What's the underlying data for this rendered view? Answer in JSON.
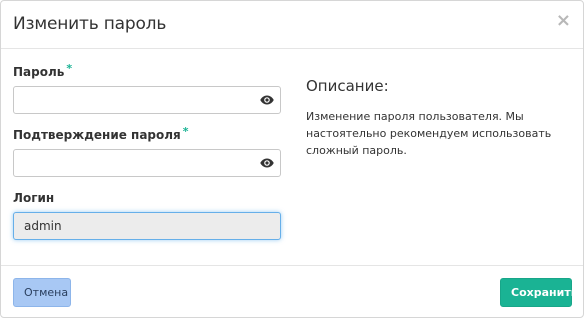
{
  "dialog": {
    "title": "Изменить пароль",
    "close_symbol": "×"
  },
  "form": {
    "password": {
      "label": "Пароль",
      "required_mark": "*",
      "value": "",
      "icon": "eye-icon"
    },
    "confirm": {
      "label": "Подтверждение пароля",
      "required_mark": "*",
      "value": "",
      "icon": "eye-icon"
    },
    "login": {
      "label": "Логин",
      "value": "admin"
    }
  },
  "description": {
    "title": "Описание:",
    "text": "Изменение пароля пользователя. Мы настоятельно рекомендуем использовать сложный пароль."
  },
  "footer": {
    "cancel_label": "Отмена",
    "save_label": "Сохранить"
  },
  "colors": {
    "accent": "#1ab394",
    "cancel_bg": "#a8c8f4",
    "focus_border": "#66afe9"
  }
}
